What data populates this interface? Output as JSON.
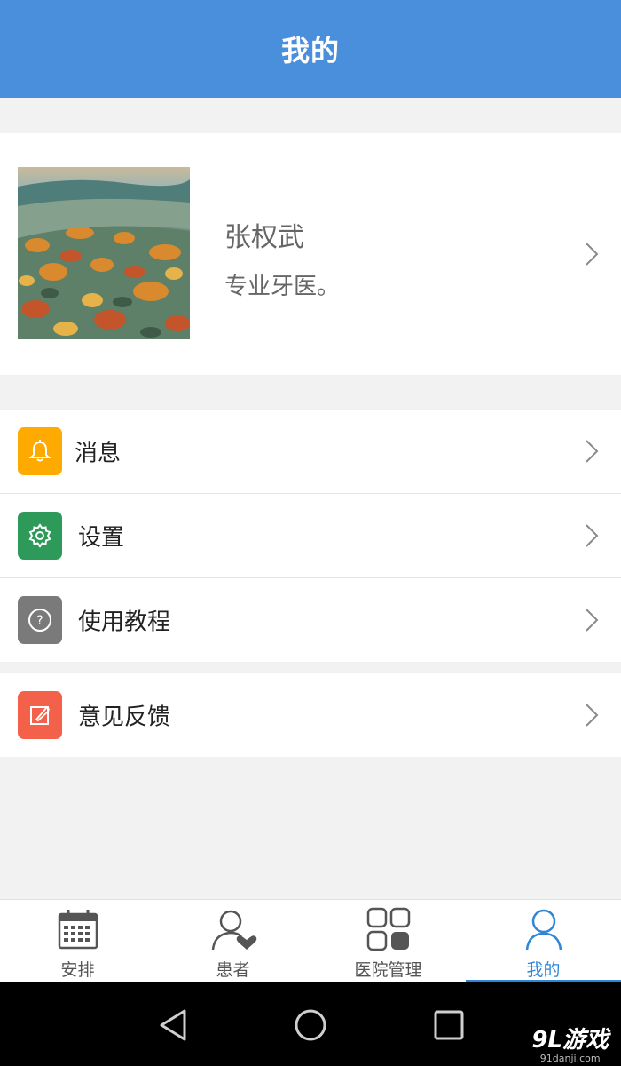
{
  "header": {
    "title": "我的"
  },
  "profile": {
    "name": "张权武",
    "bio": "专业牙医。"
  },
  "menu_groups": [
    [
      {
        "label": "消息",
        "icon": "bell-icon",
        "color": "#ffaa00"
      },
      {
        "label": "设置",
        "icon": "gear-icon",
        "color": "#2e9a5a"
      },
      {
        "label": "使用教程",
        "icon": "help-icon",
        "color": "#7a7a7a"
      }
    ],
    [
      {
        "label": "意见反馈",
        "icon": "feedback-icon",
        "color": "#f4614b"
      }
    ]
  ],
  "tabs": [
    {
      "label": "安排",
      "icon": "calendar-icon",
      "active": false
    },
    {
      "label": "患者",
      "icon": "patient-icon",
      "active": false
    },
    {
      "label": "医院管理",
      "icon": "grid-icon",
      "active": false
    },
    {
      "label": "我的",
      "icon": "person-icon",
      "active": true
    }
  ],
  "watermark": {
    "brand": "9L游戏",
    "url": "91danji.com"
  },
  "colors": {
    "accent": "#4a8fdc",
    "tab_active": "#2f86d8",
    "background": "#f2f2f2"
  }
}
